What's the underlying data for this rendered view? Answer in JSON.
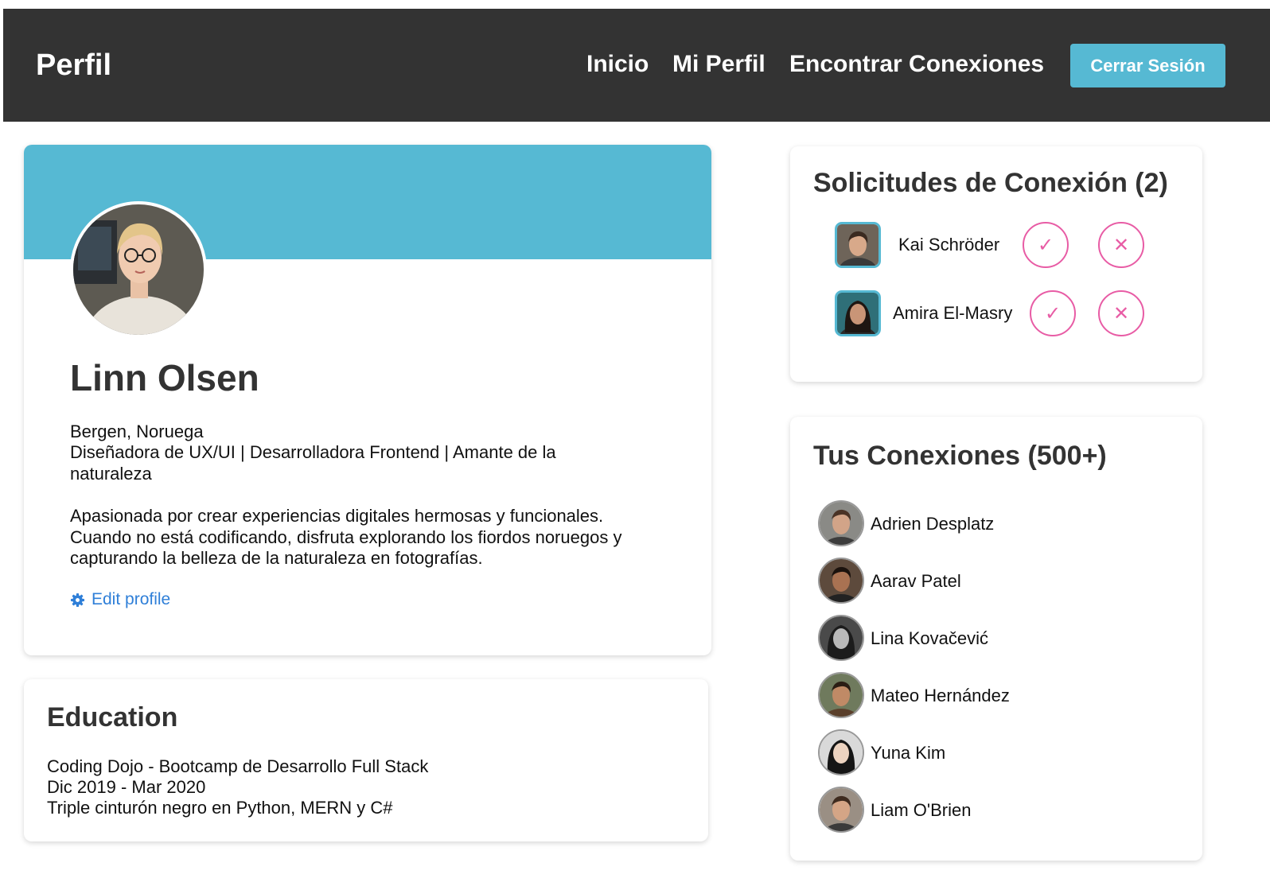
{
  "header": {
    "brand": "Perfil",
    "nav": [
      "Inicio",
      "Mi Perfil",
      "Encontrar Conexiones"
    ],
    "logout_label": "Cerrar Sesión"
  },
  "profile": {
    "name": "Linn Olsen",
    "location": "Bergen, Noruega",
    "headline": "Diseñadora de UX/UI | Desarrolladora Frontend | Amante de la naturaleza",
    "bio": "Apasionada por crear experiencias digitales hermosas y funcionales. Cuando no está codificando, disfruta explorando los fiordos noruegos y capturando la belleza de la naturaleza en fotografías.",
    "edit_label": "Edit profile",
    "accent_color": "#56b9d3"
  },
  "education": {
    "title": "Education",
    "school": "Coding Dojo - Bootcamp de Desarrollo Full Stack",
    "dates": "Dic 2019 - Mar 2020",
    "note": "Triple cinturón negro en Python, MERN y C#"
  },
  "requests": {
    "title": "Solicitudes de Conexión (2)",
    "accept_icon": "check-icon",
    "reject_icon": "close-icon",
    "items": [
      {
        "name": "Kai Schröder"
      },
      {
        "name": "Amira El-Masry"
      }
    ]
  },
  "connections": {
    "title": "Tus Conexiones (500+)",
    "items": [
      {
        "name": "Adrien Desplatz"
      },
      {
        "name": "Aarav Patel"
      },
      {
        "name": "Lina Kovačević"
      },
      {
        "name": "Mateo Hernández"
      },
      {
        "name": "Yuna Kim"
      },
      {
        "name": "Liam O'Brien"
      }
    ]
  }
}
